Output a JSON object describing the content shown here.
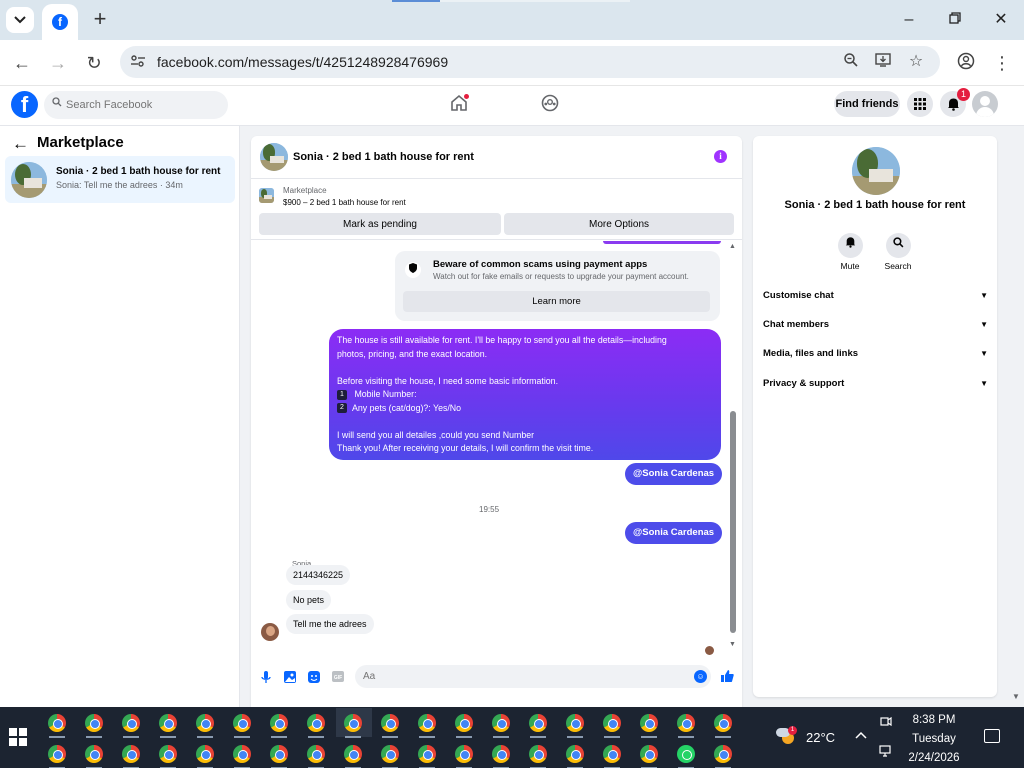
{
  "browser": {
    "url": "facebook.com/messages/t/4251248928476969",
    "icons": [
      "tab-search-icon",
      "facebook-favicon-icon",
      "plus-icon",
      "minimize-icon",
      "restore-icon",
      "close-icon",
      "back-icon",
      "forward-icon",
      "reload-icon",
      "site-info-icon",
      "zoom-icon",
      "install-icon",
      "star-icon",
      "profile-icon",
      "menu-icon"
    ]
  },
  "fb_header": {
    "search_placeholder": "Search Facebook",
    "find_friends": "Find friends",
    "notification_count": "1"
  },
  "sidebar": {
    "title": "Marketplace",
    "conversations": [
      {
        "name": "Sonia · 2 bed 1 bath house for rent",
        "preview": "Sonia: Tell me the adrees · 34m"
      }
    ]
  },
  "chat": {
    "title": "Sonia · 2 bed 1 bath house for rent",
    "listing": {
      "label": "Marketplace",
      "item": "$900 – 2 bed 1 bath house for rent",
      "mark_pending": "Mark as pending",
      "more_options": "More Options"
    },
    "scam_notice": {
      "title": "Beware of common scams using payment apps",
      "subtitle": "Watch out for fake emails or requests to upgrade your payment account.",
      "button": "Learn more"
    },
    "outgoing_message": {
      "line1": "The house is still available for rent. I'll be happy to send you all the details—including",
      "line2": "photos, pricing, and the exact location.",
      "line3": "Before visiting the house, I need some basic information.",
      "item1_num": "1",
      "item1": "Mobile Number:",
      "item2_num": "2",
      "item2": "Any pets (cat/dog)?: Yes/No",
      "line6": "I will send you all detailes ,could you send Number",
      "line7": "Thank you! After receiving your details, I will confirm the visit time."
    },
    "mention1": "@Sonia Cardenas",
    "timestamp": "19:55",
    "mention2": "@Sonia Cardenas",
    "sender_name": "Sonia",
    "incoming": [
      "2144346225",
      "No pets",
      "Tell me the adrees"
    ],
    "composer_placeholder": "Aa"
  },
  "info_panel": {
    "name": "Sonia · 2 bed 1 bath house for rent",
    "mute": "Mute",
    "search": "Search",
    "sections": [
      "Customise chat",
      "Chat members",
      "Media, files and links",
      "Privacy & support"
    ]
  },
  "taskbar": {
    "temperature": "22°C",
    "weather_badge": "1",
    "time": "8:38 PM",
    "day": "Tuesday",
    "date": "2/24/2026"
  },
  "colors": {
    "facebook_blue": "#0866ff",
    "bubble_purple": "#8c2cf5",
    "bubble_blue": "#4d4cea",
    "taskbar": "#1c2431"
  }
}
